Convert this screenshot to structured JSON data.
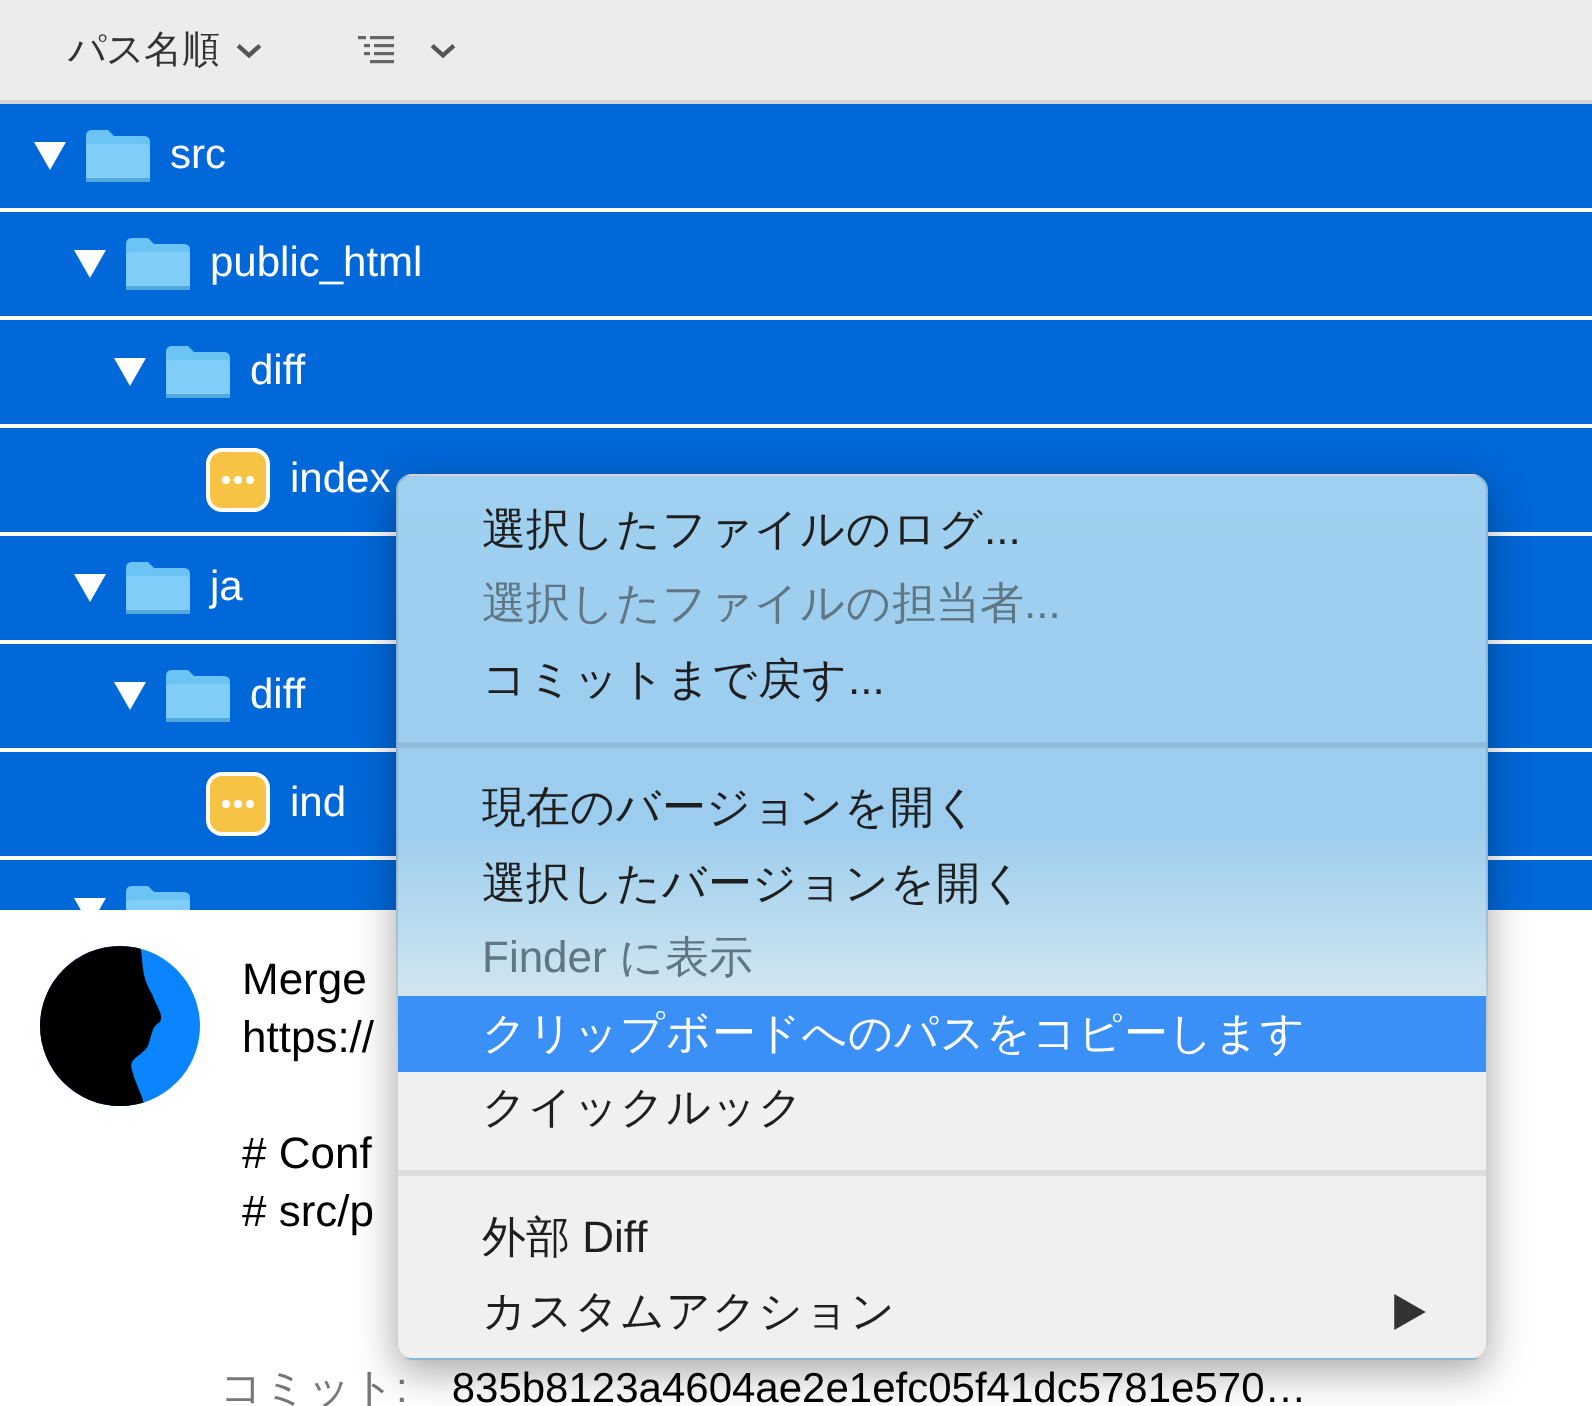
{
  "toolbar": {
    "sort_label": "パス名順"
  },
  "tree": [
    {
      "kind": "folder",
      "label": "src",
      "expanded": true,
      "children": [
        {
          "kind": "folder",
          "label": "public_html",
          "expanded": true,
          "children": [
            {
              "kind": "folder",
              "label": "diff",
              "expanded": true,
              "children": [
                {
                  "kind": "file",
                  "label": "index"
                }
              ]
            }
          ]
        },
        {
          "kind": "folder",
          "label": "ja",
          "expanded": true,
          "children": [
            {
              "kind": "folder",
              "label": "diff",
              "expanded": true,
              "children": [
                {
                  "kind": "file",
                  "label": "ind"
                }
              ]
            }
          ]
        },
        {
          "kind": "folder",
          "expanded": true
        }
      ]
    }
  ],
  "commit": {
    "message_paragraphs": [
      [
        "Merge",
        "https://"
      ],
      [
        "# Conf",
        "# src/p"
      ]
    ],
    "label": "コミット:",
    "hash": "835b8123a4604ae2e1efc05f41dc5781e570…"
  },
  "context_menu": [
    {
      "kind": "item",
      "label": "選択したファイルのログ...",
      "disabled": false,
      "selected": false,
      "submenu": false
    },
    {
      "kind": "item",
      "label": "選択したファイルの担当者...",
      "disabled": true,
      "selected": false,
      "submenu": false
    },
    {
      "kind": "item",
      "label": "コミットまで戻す...",
      "disabled": false,
      "selected": false,
      "submenu": false
    },
    {
      "kind": "separator"
    },
    {
      "kind": "item",
      "label": "現在のバージョンを開く",
      "disabled": false,
      "selected": false,
      "submenu": false
    },
    {
      "kind": "item",
      "label": "選択したバージョンを開く",
      "disabled": false,
      "selected": false,
      "submenu": false
    },
    {
      "kind": "item",
      "label": "Finder に表示",
      "disabled": true,
      "selected": false,
      "submenu": false
    },
    {
      "kind": "item",
      "label": "クリップボードへのパスをコピーします",
      "disabled": false,
      "selected": true,
      "submenu": false
    },
    {
      "kind": "item",
      "label": "クイックルック",
      "disabled": false,
      "selected": false,
      "submenu": false
    },
    {
      "kind": "separator"
    },
    {
      "kind": "item",
      "label": "外部 Diff",
      "disabled": false,
      "selected": false,
      "submenu": false
    },
    {
      "kind": "item",
      "label": "カスタムアクション",
      "disabled": false,
      "selected": false,
      "submenu": true
    }
  ]
}
